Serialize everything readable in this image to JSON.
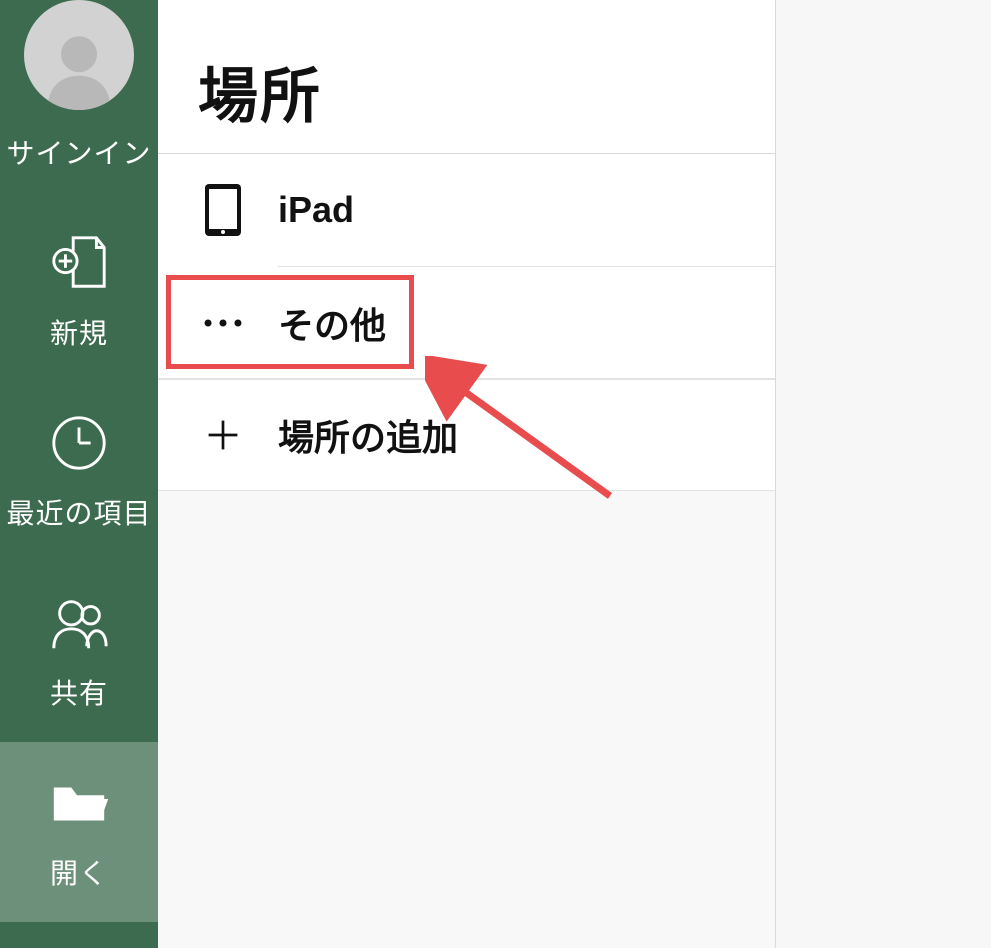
{
  "sidebar": {
    "signin_label": "サインイン",
    "items": [
      {
        "id": "new",
        "label": "新規"
      },
      {
        "id": "recent",
        "label": "最近の項目"
      },
      {
        "id": "shared",
        "label": "共有"
      },
      {
        "id": "open",
        "label": "開く"
      }
    ]
  },
  "panel": {
    "title": "場所",
    "rows": {
      "ipad": {
        "label": "iPad"
      },
      "other": {
        "label": "その他"
      },
      "add_place": {
        "label": "場所の追加"
      }
    }
  },
  "colors": {
    "sidebar_bg": "#3d6b4f",
    "highlight": "#e84c4c"
  }
}
